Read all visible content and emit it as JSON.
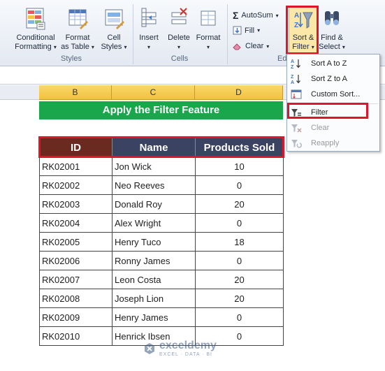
{
  "ribbon": {
    "conditional_formatting": {
      "line1": "Conditional",
      "line2": "Formatting"
    },
    "format_as_table": {
      "line1": "Format",
      "line2": "as Table"
    },
    "cell_styles": {
      "line1": "Cell",
      "line2": "Styles"
    },
    "insert": "Insert",
    "delete": "Delete",
    "format": "Format",
    "autosum": "AutoSum",
    "fill": "Fill",
    "clear": "Clear",
    "sort_filter": {
      "line1": "Sort &",
      "line2": "Filter"
    },
    "find_select": {
      "line1": "Find &",
      "line2": "Select"
    },
    "groups": {
      "styles": "Styles",
      "cells": "Cells",
      "editing": "Edi"
    }
  },
  "columns": [
    "B",
    "C",
    "D"
  ],
  "sheet": {
    "title": "Apply the Filter Feature",
    "headers": [
      "ID",
      "Name",
      "Products Sold"
    ],
    "rows": [
      [
        "RK02001",
        "Jon Wick",
        "10"
      ],
      [
        "RK02002",
        "Neo Reeves",
        "0"
      ],
      [
        "RK02003",
        "Donald Roy",
        "20"
      ],
      [
        "RK02004",
        "Alex Wright",
        "0"
      ],
      [
        "RK02005",
        "Henry Tuco",
        "18"
      ],
      [
        "RK02006",
        "Ronny James",
        "0"
      ],
      [
        "RK02007",
        "Leon Costa",
        "20"
      ],
      [
        "RK02008",
        "Joseph Lion",
        "20"
      ],
      [
        "RK02009",
        "Henry James",
        "0"
      ],
      [
        "RK02010",
        "Henrick Ibsen",
        "0"
      ]
    ]
  },
  "menu": {
    "sort_az": "Sort A to Z",
    "sort_za": "Sort Z to A",
    "custom_sort": "Custom Sort...",
    "filter": "Filter",
    "clear": "Clear",
    "reapply": "Reapply"
  },
  "watermark": {
    "name": "exceldemy",
    "sub": "EXCEL · DATA · BI"
  },
  "colors": {
    "title_green": "#1aa64b",
    "id_header": "#6b2a1f",
    "name_header": "#3b4362",
    "products_header": "#3b4362",
    "highlight_red": "#e0142a",
    "column_header_selected": "#f2c23a"
  }
}
